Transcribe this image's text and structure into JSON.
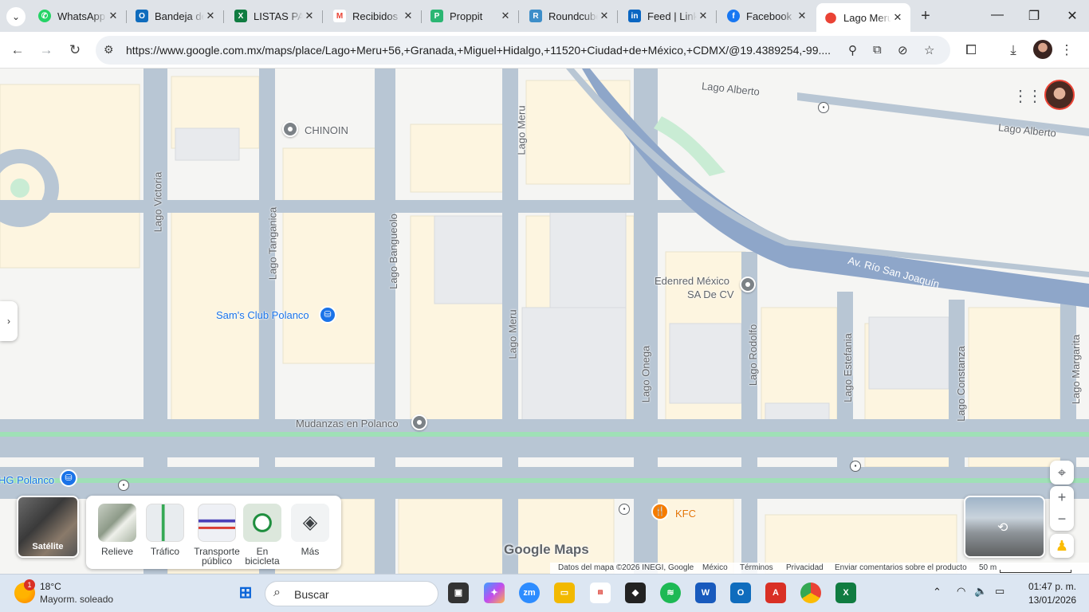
{
  "browser": {
    "tabs": [
      {
        "label": "WhatsApp",
        "icon": "whatsapp-icon",
        "color": "#25d366"
      },
      {
        "label": "Bandeja de entrada",
        "icon": "outlook-icon",
        "color": "#0f6cbd"
      },
      {
        "label": "LISTAS PA",
        "icon": "excel-icon",
        "color": "#107c41"
      },
      {
        "label": "Recibidos",
        "icon": "gmail-icon",
        "color": "#ea4335"
      },
      {
        "label": "Proppit",
        "icon": "proppit-icon",
        "color": "#2bb673"
      },
      {
        "label": "Roundcube",
        "icon": "roundcube-icon",
        "color": "#3d8ec9"
      },
      {
        "label": "Feed | LinkedIn",
        "icon": "linkedin-icon",
        "color": "#0a66c2"
      },
      {
        "label": "Facebook",
        "icon": "facebook-icon",
        "color": "#1877f2"
      },
      {
        "label": "Lago Meru",
        "icon": "google-maps-icon",
        "color": "#34a853",
        "active": true
      }
    ],
    "url": "https://www.google.com.mx/maps/place/Lago+Meru+56,+Granada,+Miguel+Hidalgo,+11520+Ciudad+de+México,+CDMX/@19.4389254,-99...."
  },
  "map": {
    "streets": {
      "lago_alberto_1": "Lago Alberto",
      "lago_alberto_2": "Lago Alberto",
      "lago_victoria": "Lago Victoria",
      "lago_tanganica": "Lago Tanganica",
      "lago_bangueolo": "Lago Bangueolo",
      "lago_meru_top": "Lago Meru",
      "lago_meru_mid": "Lago Meru",
      "lago_onega": "Lago Onega",
      "lago_rodolfo": "Lago Rodolfo",
      "lago_estefania": "Lago Estefania",
      "lago_constanza": "Lago Constanza",
      "lago_margarita": "Lago Margarita",
      "rio_san_joaquin": "Av. Río San Joaquín"
    },
    "places": {
      "chinoin": "CHINOIN",
      "sams_club": "Sam's Club Polanco",
      "edenred_1": "Edenred México",
      "edenred_2": "SA De CV",
      "mudanzas": "Mudanzas en Polanco",
      "kfc": "KFC",
      "hg_polanco": "HG Polanco"
    },
    "layers": {
      "satellite": "Satélite",
      "relief": "Relieve",
      "traffic": "Tráfico",
      "transit_1": "Transporte",
      "transit_2": "público",
      "bike_1": "En",
      "bike_2": "bicicleta",
      "more": "Más"
    },
    "logo": "Google Maps",
    "footer": {
      "data": "Datos del mapa ©2026 INEGI, Google",
      "country": "México",
      "terms": "Términos",
      "privacy": "Privacidad",
      "feedback": "Enviar comentarios sobre el producto",
      "scale": "50 m"
    }
  },
  "taskbar": {
    "weather_temp": "18°C",
    "weather_desc": "Mayorm. soleado",
    "weather_badge": "1",
    "search": "Buscar",
    "time": "01:47 p. m.",
    "date": "13/01/2026"
  }
}
